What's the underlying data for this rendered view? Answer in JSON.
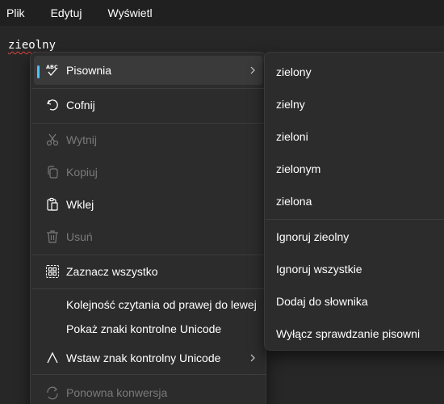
{
  "menubar": {
    "items": [
      "Plik",
      "Edytuj",
      "Wyświetl"
    ]
  },
  "editor": {
    "text": "zieolny"
  },
  "context_menu": {
    "items": [
      {
        "label": "Pisownia",
        "icon": "spellcheck-icon",
        "enabled": true,
        "submenu": true,
        "highlighted": true
      },
      {
        "label": "Cofnij",
        "icon": "undo-icon",
        "enabled": true
      },
      {
        "label": "Wytnij",
        "icon": "cut-icon",
        "enabled": false
      },
      {
        "label": "Kopiuj",
        "icon": "copy-icon",
        "enabled": false
      },
      {
        "label": "Wklej",
        "icon": "paste-icon",
        "enabled": true
      },
      {
        "label": "Usuń",
        "icon": "delete-icon",
        "enabled": false
      },
      {
        "label": "Zaznacz wszystko",
        "icon": "select-all-icon",
        "enabled": true
      },
      {
        "label": "Kolejność czytania od prawej do lewej",
        "enabled": true
      },
      {
        "label": "Pokaż znaki kontrolne Unicode",
        "enabled": true
      },
      {
        "label": "Wstaw znak kontrolny Unicode",
        "icon": "caret-icon",
        "enabled": true,
        "submenu": true
      },
      {
        "label": "Ponowna konwersja",
        "icon": "reconversion-icon",
        "enabled": false
      }
    ]
  },
  "spelling_submenu": {
    "suggestions": [
      "zielony",
      "zielny",
      "zieloni",
      "zielonym",
      "zielona"
    ],
    "actions": [
      "Ignoruj zieolny",
      "Ignoruj wszystkie",
      "Dodaj do słownika",
      "Wyłącz sprawdzanie pisowni"
    ]
  },
  "colors": {
    "background": "#272727",
    "menubar": "#202020",
    "menu": "#2c2c2c",
    "highlight": "#3a3a3a",
    "disabled_text": "#7a7a7a",
    "spell_underline": "#e0443e"
  }
}
